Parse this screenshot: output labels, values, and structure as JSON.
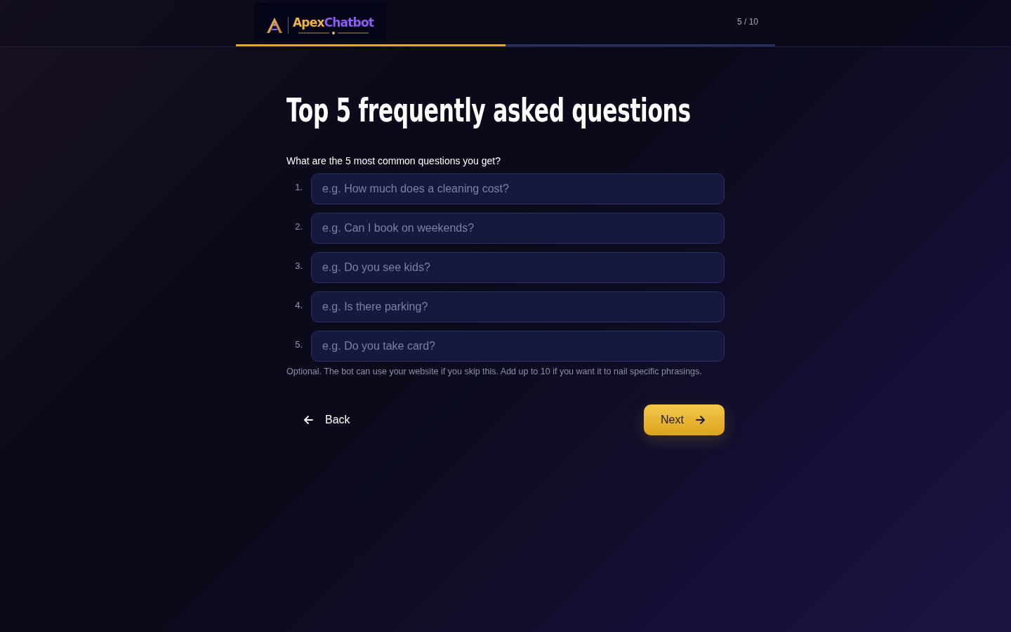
{
  "header": {
    "logo": {
      "name_primary": "Apex",
      "name_secondary": "Chatbot"
    },
    "step_counter": "5 / 10",
    "progress": {
      "level": 0.5
    }
  },
  "title": "Top 5 frequently asked questions",
  "question": {
    "label": "What are the 5 most common questions you get?",
    "fields": [
      {
        "number": "1.",
        "placeholder": "e.g. How much does a cleaning cost?"
      },
      {
        "number": "2.",
        "placeholder": "e.g. Can I book on weekends?"
      },
      {
        "number": "3.",
        "placeholder": "e.g. Do you see kids?"
      },
      {
        "number": "4.",
        "placeholder": "e.g. Is there parking?"
      },
      {
        "number": "5.",
        "placeholder": "e.g. Do you take card?"
      }
    ],
    "hint": "Optional. The bot can use your website if you skip this. Add up to 10 if you want it to nail specific phrasings."
  },
  "buttons": [
    {
      "kind": "back",
      "label": "Back"
    },
    {
      "kind": "next",
      "label": "Next"
    }
  ]
}
